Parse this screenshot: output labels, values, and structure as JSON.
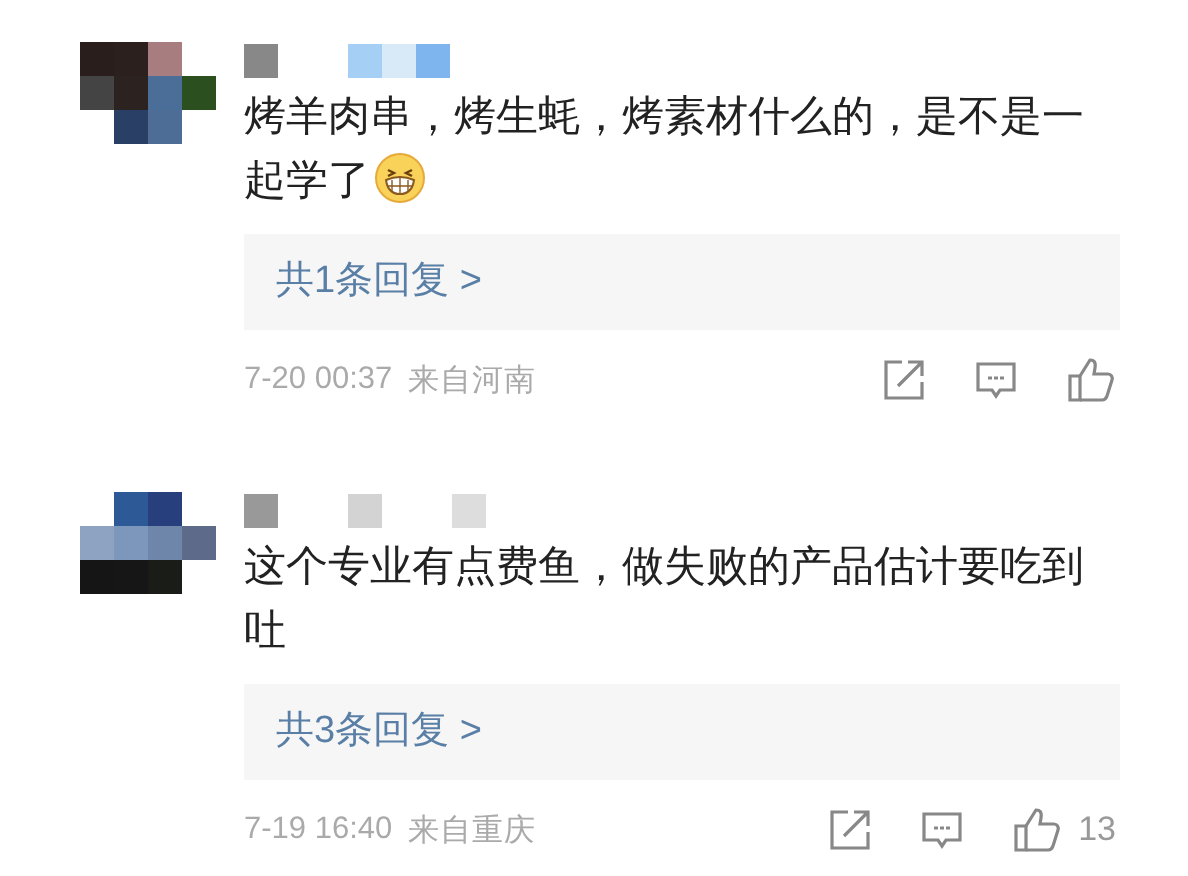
{
  "comments": [
    {
      "text": "烤羊肉串，烤生蚝，烤素材什么的，是不是一起学了",
      "trailing_emoji": true,
      "replies_link": "共1条回复 >",
      "time": "7-20 00:37",
      "location": "来自河南"
    },
    {
      "text": "这个专业有点费鱼，做失败的产品估计要吃到吐",
      "trailing_emoji": false,
      "replies_link": "共3条回复 >",
      "time": "7-19 16:40",
      "location": "来自重庆",
      "like_count": "13"
    }
  ]
}
